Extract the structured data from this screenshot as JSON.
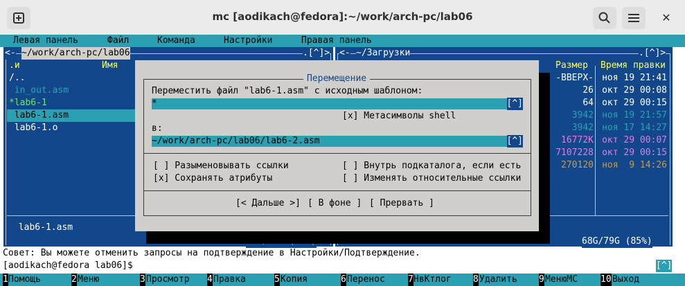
{
  "window": {
    "title": "mc [aodikach@fedora]:~/work/arch-pc/lab06",
    "new_tab_icon": "plus-square-icon",
    "search_icon": "search-icon",
    "menu_icon": "hamburger-icon",
    "close_icon": "close-icon",
    "close_glyph": "✕"
  },
  "menubar": {
    "items": [
      "Левая панель",
      "Файл",
      "Команда",
      "Настройки",
      "Правая панель"
    ]
  },
  "left_panel": {
    "path": "~/work/arch-pc/lab06",
    "ctrl": ".[^]>",
    "corner_left": "<-",
    "col_name_sort": ".и",
    "col_name": "Имя",
    "entries": [
      "/..",
      " in_out.asm",
      "*lab6-1",
      " lab6-1.asm",
      " lab6-1.o"
    ],
    "selected_name": " lab6-1.asm",
    "disk": "68G/79G (85%)"
  },
  "right_panel": {
    "path": "~/Загрузки",
    "corner_left": "<-",
    "ctrl": ".[^]>",
    "col_size": "Размер",
    "col_time": "Время правки",
    "sizes": [
      "-ВВЕРХ-",
      "26",
      "64",
      "3942",
      "3942",
      "16772K",
      "7107228",
      "270120"
    ],
    "times": [
      "ноя 19 21:41",
      "окт 29 00:08",
      "окт 29 00:15",
      "ноя 19 21:57",
      "ноя 17 14:27",
      "окт 29 00:07",
      "окт 29 00:15",
      "ноя  9 14:26"
    ],
    "disk": "68G/79G (85%)"
  },
  "dialog": {
    "title": "Перемещение",
    "prompt": "Переместить файл \"lab6-1.asm\" с исходным шаблоном:",
    "pattern_value": "*",
    "history_btn": "[^]",
    "shell_checkbox": "[x] Метасимволы shell",
    "to_label": "в:",
    "dest_value": "~/work/arch-pc/lab06/lab6-2.asm",
    "opt_deref": "[ ] Разыменовывать ссылки",
    "opt_into_subdir": "[ ] Внутрь подкаталога, если есть",
    "opt_keep_attrs": "[x] Сохранять атрибуты",
    "opt_relative": "[ ] Изменять относительные ссылки",
    "btn_continue": "[< Дальше >]",
    "btn_background": "[ В фоне ]",
    "btn_abort": "[ Прервать ]"
  },
  "hint": "Совет: Вы можете отменить запросы на подтверждение в Настройки/Подтверждение.",
  "prompt": "[aodikach@fedora lab06]$",
  "prompt_hist": "[^]",
  "fkeys": [
    {
      "num": "1",
      "label": "Помощь"
    },
    {
      "num": "2",
      "label": "Меню"
    },
    {
      "num": "3",
      "label": "Просмотр"
    },
    {
      "num": "4",
      "label": "Правка"
    },
    {
      "num": "5",
      "label": "Копия"
    },
    {
      "num": "6",
      "label": "Перенос"
    },
    {
      "num": "7",
      "label": "НвКтлог"
    },
    {
      "num": "8",
      "label": "Удалить"
    },
    {
      "num": "9",
      "label": "МенюМС"
    },
    {
      "num": "10",
      "label": "Выход"
    }
  ],
  "colors": {
    "panel_blue": "#12488b",
    "cyan": "#2aa1b3",
    "dialog_gray": "#d0cfcc",
    "size_magenta": "#e07ae0",
    "size_orange": "#c89a4a"
  }
}
